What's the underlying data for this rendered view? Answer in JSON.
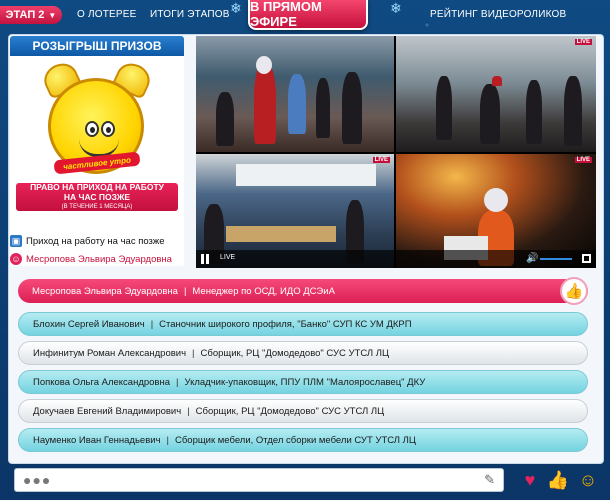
{
  "nav": {
    "stage_label": "ЭТАП 2",
    "about": "О ЛОТЕРЕЕ",
    "results": "ИТОГИ ЭТАПОВ",
    "live": "В ПРЯМОМ ЭФИРЕ",
    "rating": "РЕЙТИНГ ВИДЕОРОЛИКОВ"
  },
  "prize": {
    "title": "РОЗЫГРЫШ ПРИЗОВ",
    "clock_label": "частливое утро",
    "caption_line1": "ПРАВО НА ПРИХОД НА РАБОТУ",
    "caption_line2": "НА ЧАС ПОЗЖЕ",
    "caption_small": "(В ТЕЧЕНИЕ 1 МЕСЯЦА)",
    "prize_name": "Приход на работу на час позже",
    "winner_name": "Месропова Эльвира Эдуардовна"
  },
  "video": {
    "live_label": "LIVE"
  },
  "winners": [
    {
      "name": "Месропова Эльвира Эдуардовна",
      "role": "Менеджер по ОСД, ИДО ДСЭиА"
    },
    {
      "name": "Блохин Сергей Иванович",
      "role": "Станочник широкого профиля, \"Банко\" СУП КС УМ ДКРП"
    },
    {
      "name": "Инфинитум Роман Александрович",
      "role": "Сборщик, РЦ \"Домодедово\" СУС УТСЛ ЛЦ"
    },
    {
      "name": "Попкова Ольга Александровна",
      "role": "Укладчик-упаковщик, ППУ ПЛМ \"Малоярославец\" ДКУ"
    },
    {
      "name": "Докучаев Евгений Владимирович",
      "role": "Сборщик, РЦ \"Домодедово\" СУС УТСЛ ЛЦ"
    },
    {
      "name": "Науменко Иван Геннадьевич",
      "role": "Сборщик мебели, Отдел сборки мебели СУТ УТСЛ ЛЦ"
    }
  ],
  "sep": "|",
  "chat": {
    "placeholder": "●●●"
  },
  "colors": {
    "accent": "#c5103c",
    "brand_blue": "#0d58a5",
    "teal_row": "#73d3e0"
  }
}
